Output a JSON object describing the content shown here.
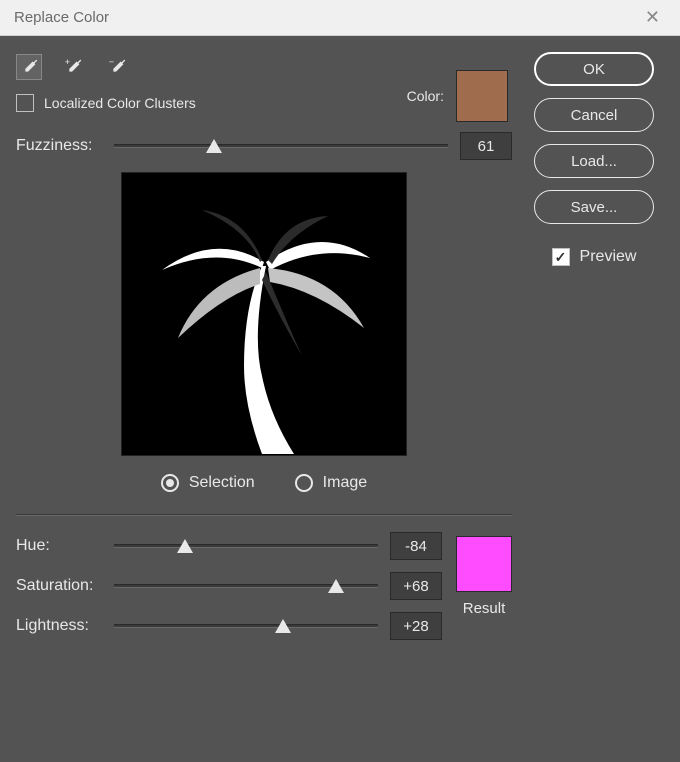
{
  "title": "Replace Color",
  "buttons": {
    "ok": "OK",
    "cancel": "Cancel",
    "load": "Load...",
    "save": "Save..."
  },
  "preview_label": "Preview",
  "preview_checked": true,
  "color_label": "Color:",
  "color_swatch": "#a06c4e",
  "localized_label": "Localized Color Clusters",
  "localized_checked": false,
  "fuzziness": {
    "label": "Fuzziness:",
    "value": "61"
  },
  "view_radio": {
    "selection": "Selection",
    "image": "Image",
    "selected": "selection"
  },
  "hue": {
    "label": "Hue:",
    "value": "-84"
  },
  "saturation": {
    "label": "Saturation:",
    "value": "+68"
  },
  "lightness": {
    "label": "Lightness:",
    "value": "+28"
  },
  "result": {
    "label": "Result",
    "color": "#ff4cff"
  },
  "icons": {
    "eyedropper": "eyedropper",
    "eyedropper_plus": "eyedropper-plus",
    "eyedropper_minus": "eyedropper-minus"
  }
}
